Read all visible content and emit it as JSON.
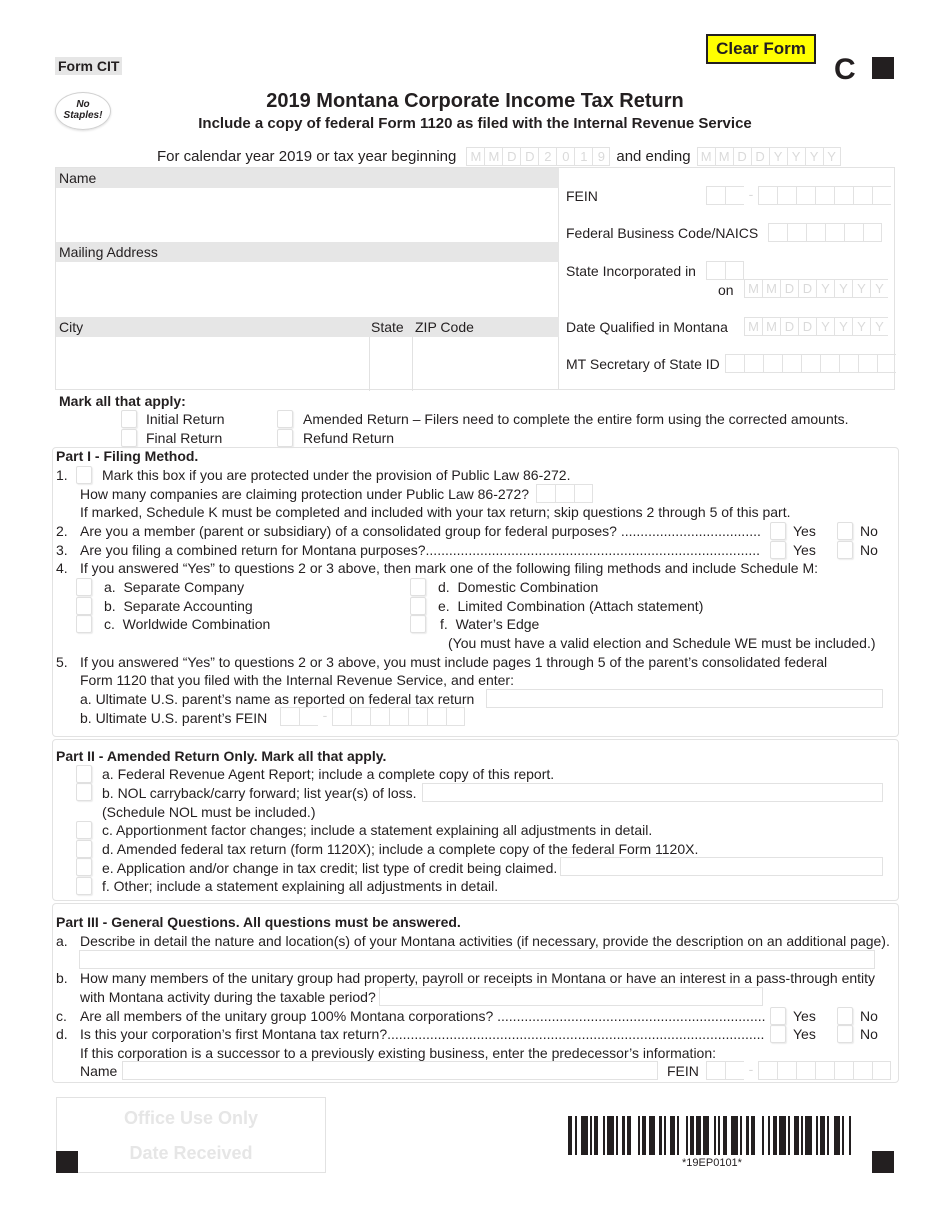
{
  "header": {
    "form_id": "Form CIT",
    "clear_form_label": "Clear Form",
    "form_letter": "C",
    "no_staples_line1": "No",
    "no_staples_line2": "Staples!",
    "title": "2019 Montana Corporate Income Tax Return",
    "subtitle": "Include a copy of federal Form 1120 as filed with the Internal Revenue Service"
  },
  "tax_year": {
    "label_begin": "For calendar year 2019 or tax year beginning",
    "begin_comb": [
      "M",
      "M",
      "D",
      "D",
      "2",
      "0",
      "1",
      "9"
    ],
    "label_end": "and ending",
    "end_comb": [
      "M",
      "M",
      "D",
      "D",
      "Y",
      "Y",
      "Y",
      "Y"
    ]
  },
  "identification": {
    "name_label": "Name",
    "address_label": "Mailing Address",
    "city_label": "City",
    "state_label": "State",
    "zip_label": "ZIP Code",
    "fein_label": "FEIN",
    "naics_label": "Federal Business Code/NAICS",
    "state_inc_label": "State Incorporated in",
    "on_label": "on",
    "date_comb": [
      "M",
      "M",
      "D",
      "D",
      "Y",
      "Y",
      "Y",
      "Y"
    ],
    "date_qualified_label": "Date Qualified in Montana",
    "sos_id_label": "MT Secretary of State ID"
  },
  "mark_all": {
    "title": "Mark all that apply:",
    "initial": "Initial Return",
    "final": "Final Return",
    "amended": "Amended Return – Filers need to complete the entire form using the corrected amounts.",
    "refund": "Refund Return"
  },
  "part1": {
    "title": "Part I - Filing Method.",
    "q1_num": "1.",
    "q1": "Mark this box if you are protected under the provision of Public Law 86-272.",
    "q1_count": "How many companies are claiming protection under Public Law 86-272?",
    "q1_note": "If marked, Schedule K must be completed and included with your tax return; skip questions 2 through 5 of this part.",
    "q2_num": "2.",
    "q2": "Are you a member (parent or subsidiary) of a consolidated group for federal purposes? ....................................",
    "q3_num": "3.",
    "q3": "Are you filing a combined return for Montana purposes?......................................................................................",
    "q4_num": "4.",
    "q4": "If you answered “Yes” to questions 2 or 3 above, then mark one of the following filing methods and include Schedule M:",
    "methods": [
      {
        "letter": "a.",
        "label": "Separate Company"
      },
      {
        "letter": "b.",
        "label": "Separate Accounting"
      },
      {
        "letter": "c.",
        "label": "Worldwide Combination"
      },
      {
        "letter": "d.",
        "label": "Domestic Combination"
      },
      {
        "letter": "e.",
        "label": "Limited Combination (Attach statement)"
      },
      {
        "letter": "f.",
        "label": "Water’s Edge"
      }
    ],
    "waters_edge_note": "(You must have a valid election and Schedule WE must be included.)",
    "q5_num": "5.",
    "q5_line1": "If you answered “Yes” to questions 2 or 3 above, you must include pages 1 through 5 of the parent’s consolidated federal",
    "q5_line2": "Form 1120 that you filed with the Internal Revenue Service, and enter:",
    "q5a": "a.  Ultimate U.S. parent’s name as reported on federal tax return",
    "q5b": "b.  Ultimate U.S. parent’s FEIN",
    "yes": "Yes",
    "no": "No"
  },
  "part2": {
    "title": "Part II - Amended Return Only. Mark all that apply.",
    "items": [
      "a. Federal Revenue Agent Report; include a complete copy of this report.",
      "b. NOL carryback/carry forward; list year(s) of loss.",
      "(Schedule NOL must be included.)",
      "c. Apportionment factor changes; include a statement explaining all adjustments in detail.",
      "d. Amended federal tax return (form 1120X); include a complete copy of the federal Form 1120X.",
      "e. Application and/or change in tax credit; list type of credit being claimed.",
      "f. Other; include a statement explaining all adjustments in detail."
    ]
  },
  "part3": {
    "title": "Part III - General Questions. All questions must be answered.",
    "qa_letter": "a.",
    "qa": "Describe in detail the nature and location(s) of your Montana activities (if necessary, provide the description on an additional page).",
    "qb_letter": "b.",
    "qb_line1": "How many members of the unitary group had property, payroll or receipts in Montana or have an interest in a pass-through entity",
    "qb_line2": "with Montana activity during the taxable period?",
    "qc_letter": "c.",
    "qc": "Are all members of the unitary group 100% Montana corporations? .....................................................................",
    "qd_letter": "d.",
    "qd": "Is this your corporation’s first Montana tax return?.................................................................................................",
    "successor_note": "If this corporation is a successor to a previously existing business, enter the predecessor’s information:",
    "name_label": "Name",
    "fein_label": "FEIN",
    "yes": "Yes",
    "no": "No"
  },
  "footer": {
    "office_use": "Office Use Only",
    "date_received": "Date Received",
    "barcode_text": "*19EP0101*"
  }
}
